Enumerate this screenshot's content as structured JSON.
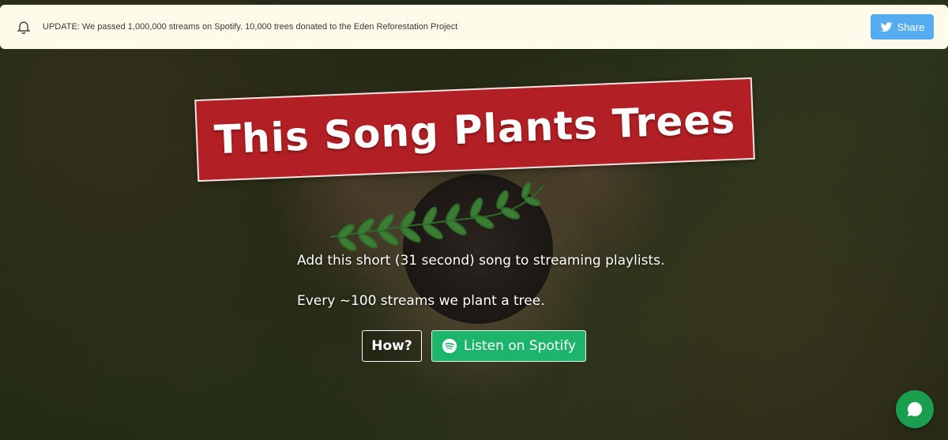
{
  "banner": {
    "text": "UPDATE: We passed 1,000,000 streams on Spotify. 10,000 trees donated to the Eden Reforestation Project",
    "icon": "bell-icon",
    "share_label": "Share",
    "share_icon": "twitter-icon",
    "share_color": "#55acee",
    "background": "#fffbea"
  },
  "hero": {
    "title": "This Song Plants Trees",
    "title_background": "#b21f24",
    "line1": "Add this short (31 second) song to streaming playlists.",
    "line2": "Every ~100 streams we plant a tree.",
    "how_label": "How?",
    "spotify_label": "Listen on Spotify",
    "spotify_icon": "spotify-icon",
    "spotify_color": "#1db56b"
  },
  "chat": {
    "icon": "chat-icon",
    "color": "#1a9e4f"
  }
}
